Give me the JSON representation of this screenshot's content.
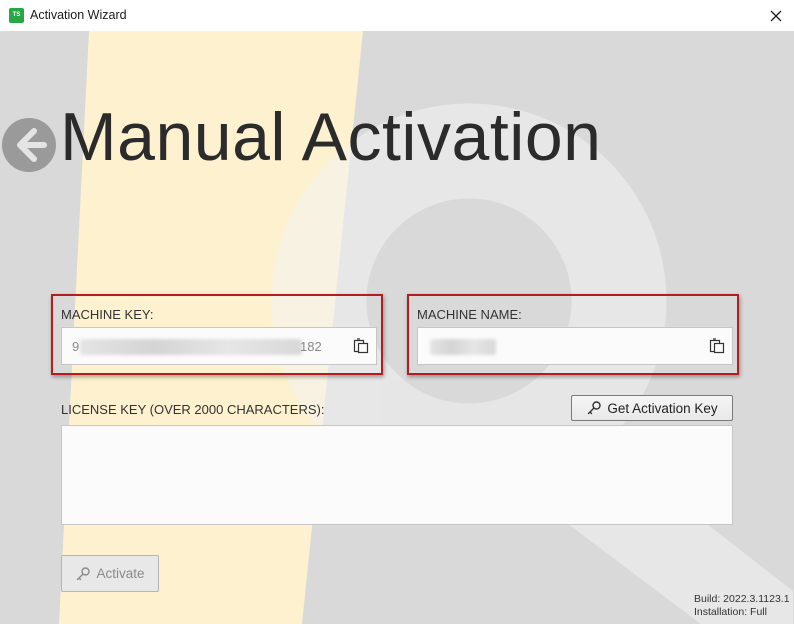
{
  "window": {
    "title": "Activation Wizard",
    "logo_text": "TS"
  },
  "icons": {
    "back": "arrow-left-circle-icon",
    "close": "close-icon",
    "copy": "copy-icon",
    "key": "key-icon"
  },
  "page": {
    "title": "Manual Activation"
  },
  "machine_key": {
    "label": "MACHINE KEY:",
    "value_prefix": "9",
    "value_suffix": "182"
  },
  "machine_name": {
    "label": "MACHINE NAME:"
  },
  "license_key": {
    "label": "LICENSE KEY (OVER 2000 CHARACTERS):",
    "value": ""
  },
  "buttons": {
    "get_activation_key": "Get Activation Key",
    "activate": "Activate"
  },
  "footer": {
    "build": "Build: 2022.3.1123.1",
    "installation": "Installation: Full"
  },
  "colors": {
    "highlight": "#b01e22",
    "accent_stripe": "#fdf1cf",
    "logo": "#27a844"
  }
}
